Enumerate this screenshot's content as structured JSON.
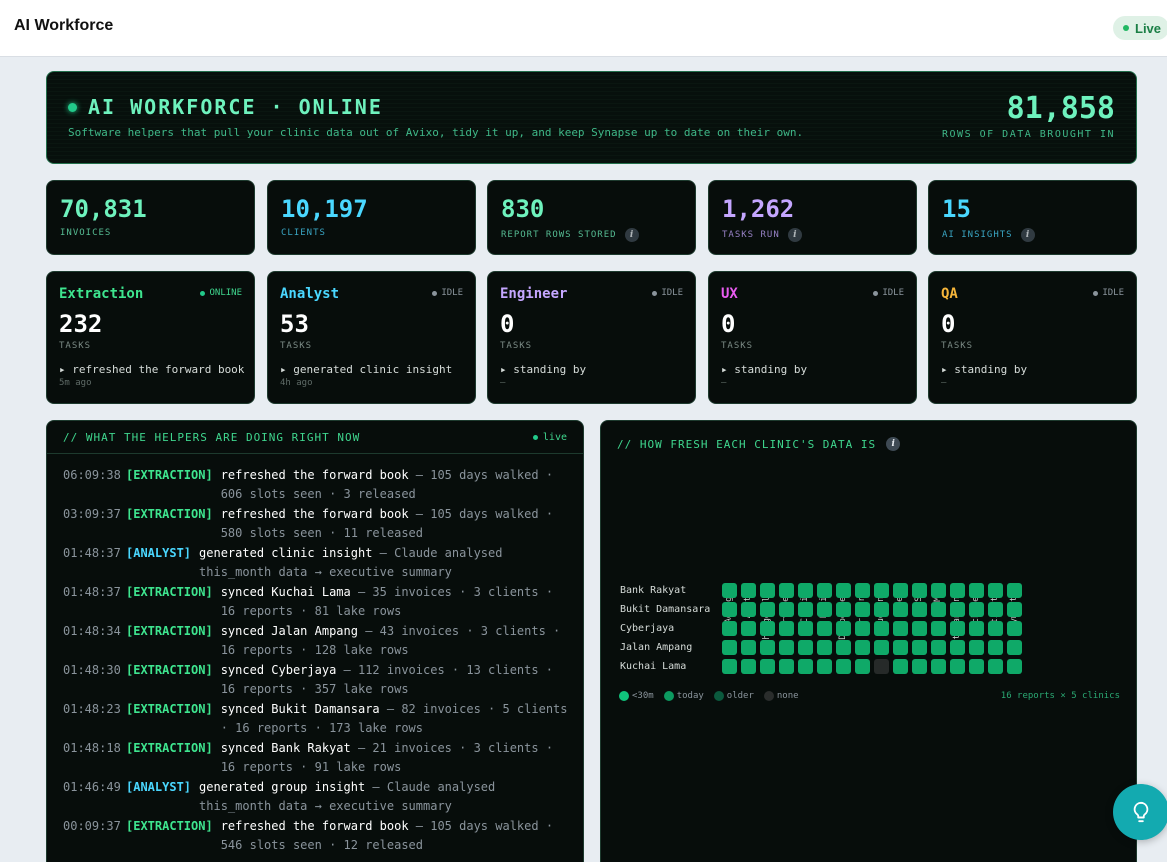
{
  "header": {
    "title": "AI Workforce",
    "live_label": "Live"
  },
  "hero": {
    "title": "AI WORKFORCE · ONLINE",
    "subtitle": "Software helpers that pull your clinic data out of Avixo, tidy it up, and keep Synapse up to date on their own.",
    "rows_value": "81,858",
    "rows_label": "ROWS OF DATA BROUGHT IN"
  },
  "stats": [
    {
      "value": "70,831",
      "label": "INVOICES",
      "color": "#6ef2bd",
      "info": false
    },
    {
      "value": "10,197",
      "label": "CLIENTS",
      "color": "#4ad7ff",
      "info": false
    },
    {
      "value": "830",
      "label": "REPORT ROWS STORED",
      "color": "#6ef2bd",
      "info": true
    },
    {
      "value": "1,262",
      "label": "TASKS RUN",
      "color": "#c4a6ff",
      "info": true
    },
    {
      "value": "15",
      "label": "AI INSIGHTS",
      "color": "#4ad7ff",
      "info": true
    }
  ],
  "agents": [
    {
      "name": "Extraction",
      "color": "#3ee58f",
      "status": "ONLINE",
      "online": true,
      "count": "232",
      "tasks_label": "TASKS",
      "activity": "▸ refreshed the forward book",
      "time": "5m ago"
    },
    {
      "name": "Analyst",
      "color": "#4ad7ff",
      "status": "IDLE",
      "online": false,
      "count": "53",
      "tasks_label": "TASKS",
      "activity": "▸ generated clinic insight",
      "time": "4h ago"
    },
    {
      "name": "Engineer",
      "color": "#c4a6ff",
      "status": "IDLE",
      "online": false,
      "count": "0",
      "tasks_label": "TASKS",
      "activity": "▸ standing by",
      "time": "—"
    },
    {
      "name": "UX",
      "color": "#e85cf0",
      "status": "IDLE",
      "online": false,
      "count": "0",
      "tasks_label": "TASKS",
      "activity": "▸ standing by",
      "time": "—"
    },
    {
      "name": "QA",
      "color": "#f5b53a",
      "status": "IDLE",
      "online": false,
      "count": "0",
      "tasks_label": "TASKS",
      "activity": "▸ standing by",
      "time": "—"
    }
  ],
  "log": {
    "title": "// WHAT THE HELPERS ARE DOING RIGHT NOW",
    "live_label": "live",
    "entries": [
      {
        "time": "06:09:38",
        "tag": "[EXTRACTION]",
        "kind": "extraction",
        "main": "refreshed the forward book",
        "detail": " — 105 days walked · 606 slots seen · 3 released"
      },
      {
        "time": "03:09:37",
        "tag": "[EXTRACTION]",
        "kind": "extraction",
        "main": "refreshed the forward book",
        "detail": " — 105 days walked · 580 slots seen · 11 released"
      },
      {
        "time": "01:48:37",
        "tag": "[ANALYST]",
        "kind": "analyst",
        "main": "generated clinic insight",
        "detail": " — Claude analysed this_month data → executive summary"
      },
      {
        "time": "01:48:37",
        "tag": "[EXTRACTION]",
        "kind": "extraction",
        "main": "synced Kuchai Lama",
        "detail": " — 35 invoices · 3 clients · 16 reports · 81 lake rows"
      },
      {
        "time": "01:48:34",
        "tag": "[EXTRACTION]",
        "kind": "extraction",
        "main": "synced Jalan Ampang",
        "detail": " — 43 invoices · 3 clients · 16 reports · 128 lake rows"
      },
      {
        "time": "01:48:30",
        "tag": "[EXTRACTION]",
        "kind": "extraction",
        "main": "synced Cyberjaya",
        "detail": " — 112 invoices · 13 clients · 16 reports · 357 lake rows"
      },
      {
        "time": "01:48:23",
        "tag": "[EXTRACTION]",
        "kind": "extraction",
        "main": "synced Bukit Damansara",
        "detail": " — 82 invoices · 5 clients · 16 reports · 173 lake rows"
      },
      {
        "time": "01:48:18",
        "tag": "[EXTRACTION]",
        "kind": "extraction",
        "main": "synced Bank Rakyat",
        "detail": " — 21 invoices · 3 clients · 16 reports · 91 lake rows"
      },
      {
        "time": "01:46:49",
        "tag": "[ANALYST]",
        "kind": "analyst",
        "main": "generated group insight",
        "detail": " — Claude analysed this_month data → executive summary"
      },
      {
        "time": "00:09:37",
        "tag": "[EXTRACTION]",
        "kind": "extraction",
        "main": "refreshed the forward book",
        "detail": " — 105 days walked · 546 slots seen · 12 released"
      }
    ]
  },
  "freshness": {
    "title": "// HOW FRESH EACH CLINIC'S DATA IS",
    "reports": [
      "Agings",
      "Appts",
      "Chargeable",
      "Services",
      "Credit",
      "Debit",
      "Dispenses",
      "Dr perf",
      "Drug inv",
      "Fees",
      "GST",
      "MC",
      "Outstanding",
      "Packages",
      "Patients",
      "Payments"
    ],
    "clinics": [
      {
        "name": "Bank Rakyat",
        "cells": [
          "r",
          "r",
          "r",
          "r",
          "r",
          "r",
          "r",
          "r",
          "r",
          "r",
          "r",
          "r",
          "r",
          "r",
          "r",
          "r"
        ]
      },
      {
        "name": "Bukit Damansara",
        "cells": [
          "r",
          "r",
          "r",
          "r",
          "r",
          "r",
          "r",
          "r",
          "r",
          "r",
          "r",
          "r",
          "r",
          "r",
          "r",
          "r"
        ]
      },
      {
        "name": "Cyberjaya",
        "cells": [
          "r",
          "r",
          "r",
          "r",
          "r",
          "r",
          "r",
          "r",
          "r",
          "r",
          "r",
          "r",
          "r",
          "r",
          "r",
          "r"
        ]
      },
      {
        "name": "Jalan Ampang",
        "cells": [
          "r",
          "r",
          "r",
          "r",
          "r",
          "r",
          "r",
          "r",
          "r",
          "r",
          "r",
          "r",
          "r",
          "r",
          "r",
          "r"
        ]
      },
      {
        "name": "Kuchai Lama",
        "cells": [
          "r",
          "r",
          "r",
          "r",
          "r",
          "r",
          "r",
          "r",
          "n",
          "r",
          "r",
          "r",
          "r",
          "r",
          "r",
          "r"
        ]
      }
    ],
    "legend": [
      {
        "key": "r",
        "label": "<30m",
        "color": "#10c47c"
      },
      {
        "key": "t",
        "label": "today",
        "color": "#0c9a60"
      },
      {
        "key": "o",
        "label": "older",
        "color": "#0b5a3e"
      },
      {
        "key": "n",
        "label": "none",
        "color": "#2a2d2c"
      }
    ],
    "cell_colors": {
      "r": "#0fa968",
      "t": "#0c9a60",
      "o": "#0b5a3e",
      "n": "#262a29"
    },
    "note": "16 reports × 5 clinics"
  },
  "fab": {
    "icon": "lightbulb-icon"
  }
}
